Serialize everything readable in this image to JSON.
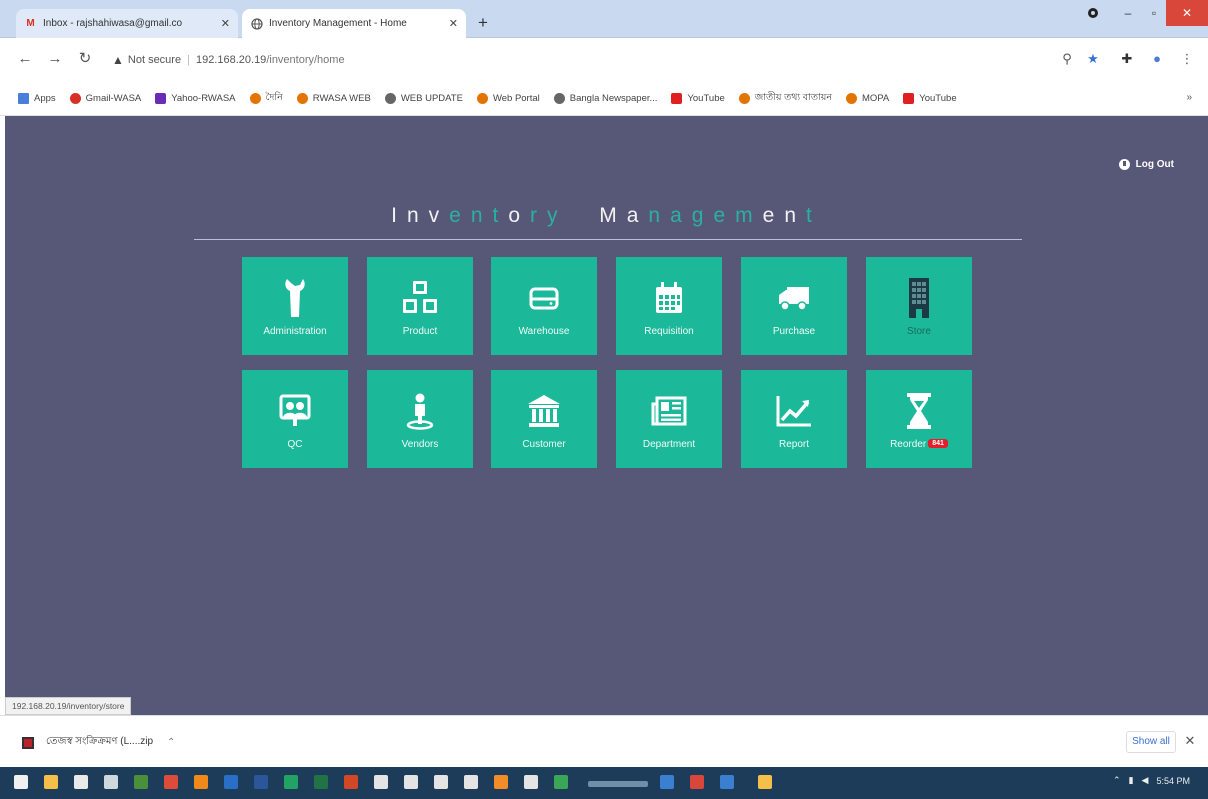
{
  "browser": {
    "tabs": [
      {
        "title": "Inbox - rajshahiwasa@gmail.co",
        "favicon": "gmail-icon",
        "active": false
      },
      {
        "title": "Inventory Management - Home",
        "favicon": "globe-icon",
        "active": true
      }
    ],
    "new_tab": "+",
    "window_controls": {
      "minimize": "–",
      "maximize": "▫",
      "close": "✕"
    },
    "address": {
      "security": "Not secure",
      "host": "192.168.20.19",
      "path": "/inventory/home"
    },
    "bookmarks": [
      {
        "label": "Apps",
        "color": "#4a7fd9"
      },
      {
        "label": "Gmail-WASA",
        "color": "#d93025"
      },
      {
        "label": "Yahoo-RWASA",
        "color": "#6a2bb7"
      },
      {
        "label": "দৈনি",
        "color": "#e37400"
      },
      {
        "label": "RWASA WEB",
        "color": "#e37400"
      },
      {
        "label": "WEB UPDATE",
        "color": "#666666"
      },
      {
        "label": "Web Portal",
        "color": "#e37400"
      },
      {
        "label": "Bangla Newspaper...",
        "color": "#666666"
      },
      {
        "label": "YouTube",
        "color": "#e02020"
      },
      {
        "label": "জাতীয় তথ্য বাতায়ন",
        "color": "#e37400"
      },
      {
        "label": "MOPA",
        "color": "#e37400"
      },
      {
        "label": "YouTube",
        "color": "#e02020"
      }
    ],
    "bookmarks_more": "»"
  },
  "page": {
    "background": "#575778",
    "tile_color": "#1cb89a",
    "logout_label": "Log Out",
    "title_word1": "Inventory",
    "title_word2": "Management",
    "tiles_row1": [
      {
        "label": "Administration",
        "icon": "wrench-icon"
      },
      {
        "label": "Product",
        "icon": "cubes-icon"
      },
      {
        "label": "Warehouse",
        "icon": "hdd-icon"
      },
      {
        "label": "Requisition",
        "icon": "calendar-icon"
      },
      {
        "label": "Purchase",
        "icon": "truck-icon"
      },
      {
        "label": "Store",
        "icon": "building-icon"
      }
    ],
    "tiles_row2": [
      {
        "label": "QC",
        "icon": "users-board-icon"
      },
      {
        "label": "Vendors",
        "icon": "person-pin-icon"
      },
      {
        "label": "Customer",
        "icon": "bank-icon"
      },
      {
        "label": "Department",
        "icon": "newspaper-icon"
      },
      {
        "label": "Report",
        "icon": "line-chart-icon"
      },
      {
        "label": "Reorder",
        "icon": "hourglass-icon",
        "badge": "841"
      }
    ],
    "status_url": "192.168.20.19/inventory/store"
  },
  "downloads": {
    "file_name": "তেজস্ব সংক্রিক্রমণ (L....zip",
    "show_all": "Show all",
    "close": "✕"
  },
  "taskbar": {
    "clock": "5:54 PM"
  }
}
